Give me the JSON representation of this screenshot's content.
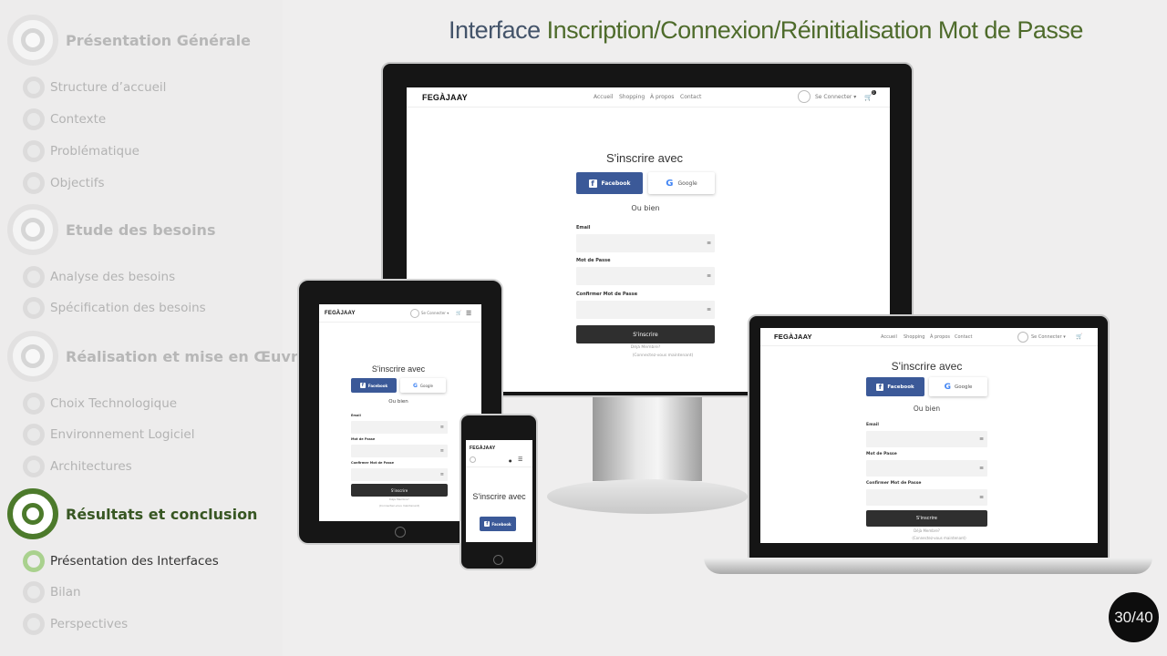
{
  "title": {
    "part1": "Interface ",
    "part2": "Inscription/Connexion/Réinitialisation Mot de Passe"
  },
  "sidebar": {
    "sections": [
      {
        "label": "Présentation Générale",
        "subs": [
          "Structure  d’accueil",
          "Contexte",
          "Problématique",
          "Objectifs"
        ]
      },
      {
        "label": "Etude des besoins",
        "subs": [
          "Analyse des besoins",
          "Spécification des besoins"
        ]
      },
      {
        "label": "Réalisation et mise en Œuvre",
        "subs": [
          "Choix Technologique",
          "Environnement  Logiciel",
          "Architectures"
        ]
      },
      {
        "label": "Résultats et conclusion",
        "subs": [
          "Présentation des Interfaces",
          "Bilan",
          "Perspectives"
        ]
      }
    ]
  },
  "page_number": "30/40",
  "site": {
    "brand": "FEGÀJAAY",
    "nav": [
      "Accueil",
      "Shopping",
      "À propos",
      "Contact"
    ],
    "account": "Se Connecter ▾",
    "cart_count": "0",
    "form_title": "S'inscrire avec",
    "facebook": "Facebook",
    "google": "Google",
    "or": "Ou bien",
    "email_label": "Email",
    "password_label": "Mot de Passe",
    "confirm_label": "Confirmer Mot de Passe",
    "submit": "S'inscrire",
    "forgot": "Déjà Membre?",
    "login_link": "(Connectez-vous maintenant)"
  },
  "colors": {
    "accent": "#4c7a2b",
    "facebook": "#3b5998",
    "title_blue": "#44546a",
    "title_green": "#4e6b2b"
  }
}
